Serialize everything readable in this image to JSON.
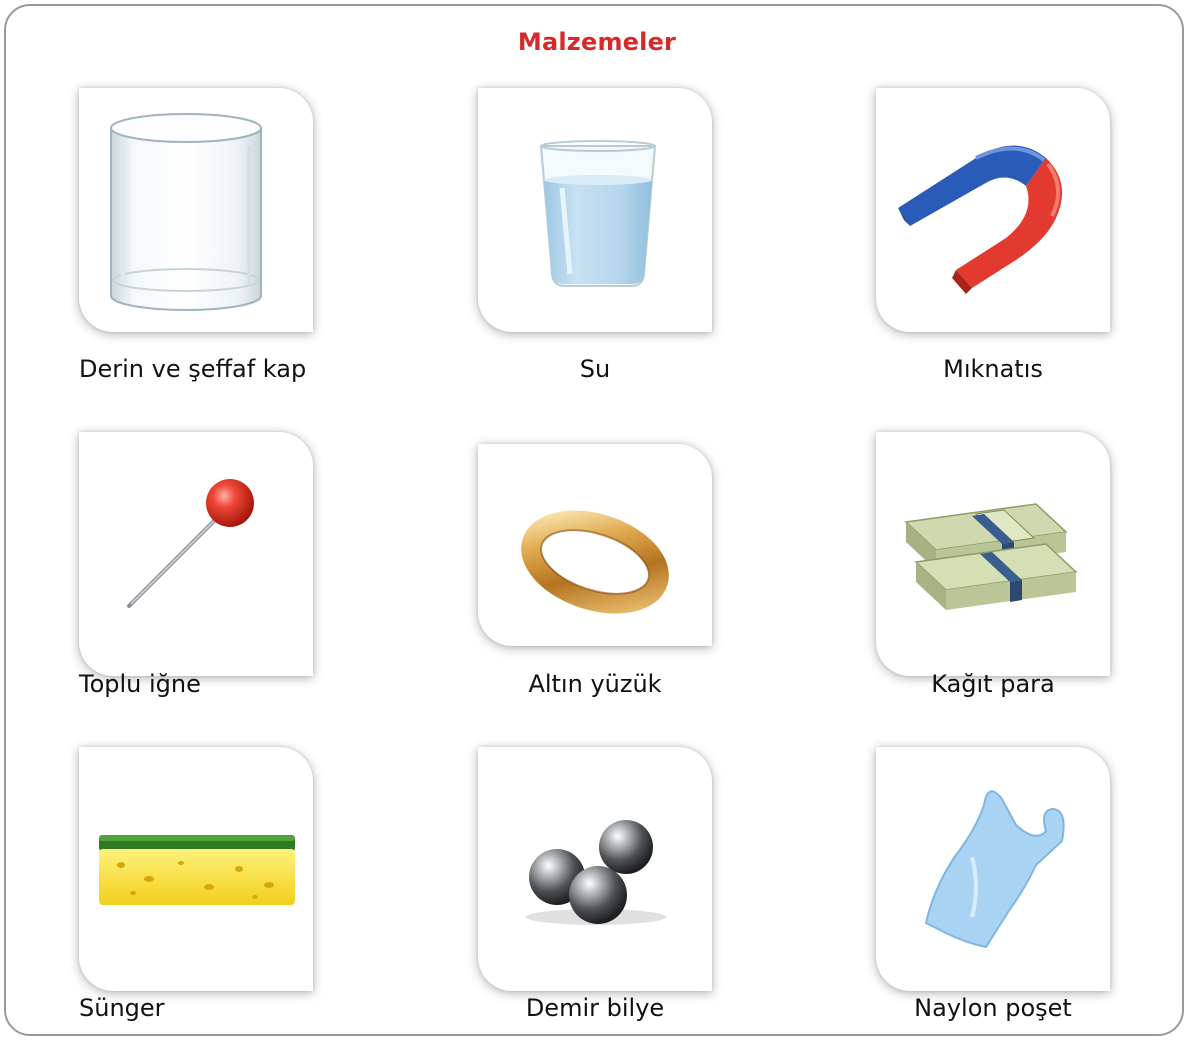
{
  "title": "Malzemeler",
  "title_color": "#d42a2a",
  "items": [
    {
      "label": "Derin ve şeffaf kap",
      "icon": "glass-container-icon"
    },
    {
      "label": "Su",
      "icon": "water-glass-icon"
    },
    {
      "label": "Mıknatıs",
      "icon": "magnet-icon"
    },
    {
      "label": "Toplu iğne",
      "icon": "pin-icon"
    },
    {
      "label": "Altın yüzük",
      "icon": "gold-ring-icon"
    },
    {
      "label": "Kağıt para",
      "icon": "paper-money-icon"
    },
    {
      "label": "Sünger",
      "icon": "sponge-icon"
    },
    {
      "label": "Demir bilye",
      "icon": "iron-balls-icon"
    },
    {
      "label": "Naylon poşet",
      "icon": "plastic-bag-icon"
    }
  ]
}
